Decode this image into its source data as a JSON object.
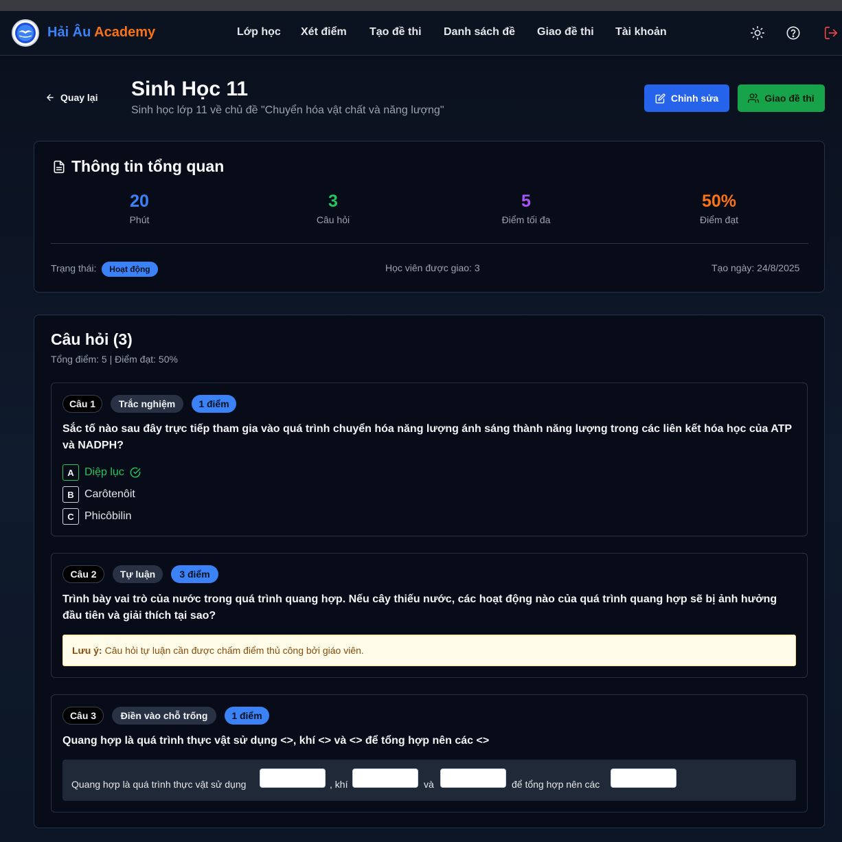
{
  "brand": {
    "part1": "Hải Âu",
    "part2": "Academy"
  },
  "nav": {
    "items": [
      "Lớp học",
      "Xét điểm",
      "Tạo đề thi",
      "Danh sách đề",
      "Giao đề thi",
      "Tài khoản"
    ],
    "icons": [
      "sun-icon",
      "help-circle-icon",
      "logout-icon"
    ]
  },
  "header": {
    "back_label": "Quay lại",
    "title": "Sinh Học 11",
    "subtitle": "Sinh học lớp 11 về chủ đề \"Chuyển hóa vật chất và năng lượng\"",
    "edit_label": "Chỉnh sửa",
    "assign_label": "Giao đề thi"
  },
  "overview": {
    "title": "Thông tin tổng quan",
    "stats": [
      {
        "value": "20",
        "label": "Phút",
        "color": "#3b82f6"
      },
      {
        "value": "3",
        "label": "Câu hỏi",
        "color": "#22c55e"
      },
      {
        "value": "5",
        "label": "Điểm tối đa",
        "color": "#a855f7"
      },
      {
        "value": "50%",
        "label": "Điểm đạt",
        "color": "#f97316"
      }
    ],
    "status_label": "Trạng thái:",
    "status_value": "Hoạt động",
    "assigned_students": "Học viên được giao: 3",
    "created_date": "Tạo ngày: 24/8/2025"
  },
  "questions": {
    "title": "Câu hỏi (3)",
    "summary": "Tổng điểm: 5 | Điểm đạt: 50%",
    "q1": {
      "number": "Câu 1",
      "type": "Trắc nghiệm",
      "points": "1 điểm",
      "text": "Sắc tố nào sau đây trực tiếp tham gia vào quá trình chuyển hóa năng lượng ánh sáng thành năng lượng trong các liên kết hóa học của ATP và NADPH?",
      "options": [
        {
          "letter": "A",
          "text": "Diệp lục"
        },
        {
          "letter": "B",
          "text": "Carôtenôit"
        },
        {
          "letter": "C",
          "text": "Phicôbilin"
        }
      ]
    },
    "q2": {
      "number": "Câu 2",
      "type": "Tự luận",
      "points": "3 điểm",
      "text": "Trình bày vai trò của nước trong quá trình quang hợp. Nếu cây thiếu nước, các hoạt động nào của quá trình quang hợp sẽ bị ảnh hưởng đầu tiên và giải thích tại sao?",
      "note_label": "Lưu ý:",
      "note_text": "Câu hỏi tự luận cần được chấm điểm thủ công bởi giáo viên."
    },
    "q3": {
      "number": "Câu 3",
      "type": "Điền vào chỗ trống",
      "points": "1 điểm",
      "text": "Quang hợp là quá trình thực vật sử dụng <>, khí <> và <> để tổng hợp nên các <>",
      "segments": [
        "Quang hợp là quá trình thực vật sử dụng",
        ", khí",
        "và",
        "để tổng hợp nên các"
      ]
    }
  }
}
